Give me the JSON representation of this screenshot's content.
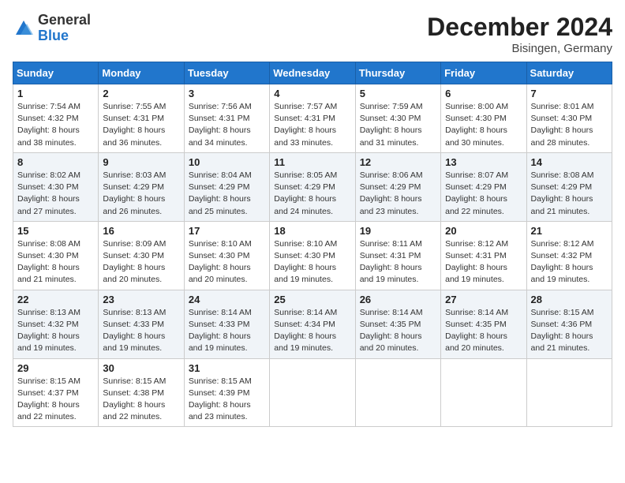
{
  "logo": {
    "text_general": "General",
    "text_blue": "Blue"
  },
  "header": {
    "month_year": "December 2024",
    "location": "Bisingen, Germany"
  },
  "weekdays": [
    "Sunday",
    "Monday",
    "Tuesday",
    "Wednesday",
    "Thursday",
    "Friday",
    "Saturday"
  ],
  "weeks": [
    {
      "alt": false,
      "days": [
        {
          "num": "1",
          "sunrise": "7:54 AM",
          "sunset": "4:32 PM",
          "daylight": "8 hours and 38 minutes."
        },
        {
          "num": "2",
          "sunrise": "7:55 AM",
          "sunset": "4:31 PM",
          "daylight": "8 hours and 36 minutes."
        },
        {
          "num": "3",
          "sunrise": "7:56 AM",
          "sunset": "4:31 PM",
          "daylight": "8 hours and 34 minutes."
        },
        {
          "num": "4",
          "sunrise": "7:57 AM",
          "sunset": "4:31 PM",
          "daylight": "8 hours and 33 minutes."
        },
        {
          "num": "5",
          "sunrise": "7:59 AM",
          "sunset": "4:30 PM",
          "daylight": "8 hours and 31 minutes."
        },
        {
          "num": "6",
          "sunrise": "8:00 AM",
          "sunset": "4:30 PM",
          "daylight": "8 hours and 30 minutes."
        },
        {
          "num": "7",
          "sunrise": "8:01 AM",
          "sunset": "4:30 PM",
          "daylight": "8 hours and 28 minutes."
        }
      ]
    },
    {
      "alt": true,
      "days": [
        {
          "num": "8",
          "sunrise": "8:02 AM",
          "sunset": "4:30 PM",
          "daylight": "8 hours and 27 minutes."
        },
        {
          "num": "9",
          "sunrise": "8:03 AM",
          "sunset": "4:29 PM",
          "daylight": "8 hours and 26 minutes."
        },
        {
          "num": "10",
          "sunrise": "8:04 AM",
          "sunset": "4:29 PM",
          "daylight": "8 hours and 25 minutes."
        },
        {
          "num": "11",
          "sunrise": "8:05 AM",
          "sunset": "4:29 PM",
          "daylight": "8 hours and 24 minutes."
        },
        {
          "num": "12",
          "sunrise": "8:06 AM",
          "sunset": "4:29 PM",
          "daylight": "8 hours and 23 minutes."
        },
        {
          "num": "13",
          "sunrise": "8:07 AM",
          "sunset": "4:29 PM",
          "daylight": "8 hours and 22 minutes."
        },
        {
          "num": "14",
          "sunrise": "8:08 AM",
          "sunset": "4:29 PM",
          "daylight": "8 hours and 21 minutes."
        }
      ]
    },
    {
      "alt": false,
      "days": [
        {
          "num": "15",
          "sunrise": "8:08 AM",
          "sunset": "4:30 PM",
          "daylight": "8 hours and 21 minutes."
        },
        {
          "num": "16",
          "sunrise": "8:09 AM",
          "sunset": "4:30 PM",
          "daylight": "8 hours and 20 minutes."
        },
        {
          "num": "17",
          "sunrise": "8:10 AM",
          "sunset": "4:30 PM",
          "daylight": "8 hours and 20 minutes."
        },
        {
          "num": "18",
          "sunrise": "8:10 AM",
          "sunset": "4:30 PM",
          "daylight": "8 hours and 19 minutes."
        },
        {
          "num": "19",
          "sunrise": "8:11 AM",
          "sunset": "4:31 PM",
          "daylight": "8 hours and 19 minutes."
        },
        {
          "num": "20",
          "sunrise": "8:12 AM",
          "sunset": "4:31 PM",
          "daylight": "8 hours and 19 minutes."
        },
        {
          "num": "21",
          "sunrise": "8:12 AM",
          "sunset": "4:32 PM",
          "daylight": "8 hours and 19 minutes."
        }
      ]
    },
    {
      "alt": true,
      "days": [
        {
          "num": "22",
          "sunrise": "8:13 AM",
          "sunset": "4:32 PM",
          "daylight": "8 hours and 19 minutes."
        },
        {
          "num": "23",
          "sunrise": "8:13 AM",
          "sunset": "4:33 PM",
          "daylight": "8 hours and 19 minutes."
        },
        {
          "num": "24",
          "sunrise": "8:14 AM",
          "sunset": "4:33 PM",
          "daylight": "8 hours and 19 minutes."
        },
        {
          "num": "25",
          "sunrise": "8:14 AM",
          "sunset": "4:34 PM",
          "daylight": "8 hours and 19 minutes."
        },
        {
          "num": "26",
          "sunrise": "8:14 AM",
          "sunset": "4:35 PM",
          "daylight": "8 hours and 20 minutes."
        },
        {
          "num": "27",
          "sunrise": "8:14 AM",
          "sunset": "4:35 PM",
          "daylight": "8 hours and 20 minutes."
        },
        {
          "num": "28",
          "sunrise": "8:15 AM",
          "sunset": "4:36 PM",
          "daylight": "8 hours and 21 minutes."
        }
      ]
    },
    {
      "alt": false,
      "days": [
        {
          "num": "29",
          "sunrise": "8:15 AM",
          "sunset": "4:37 PM",
          "daylight": "8 hours and 22 minutes."
        },
        {
          "num": "30",
          "sunrise": "8:15 AM",
          "sunset": "4:38 PM",
          "daylight": "8 hours and 22 minutes."
        },
        {
          "num": "31",
          "sunrise": "8:15 AM",
          "sunset": "4:39 PM",
          "daylight": "8 hours and 23 minutes."
        },
        null,
        null,
        null,
        null
      ]
    }
  ],
  "labels": {
    "sunrise": "Sunrise: ",
    "sunset": "Sunset: ",
    "daylight": "Daylight: "
  }
}
